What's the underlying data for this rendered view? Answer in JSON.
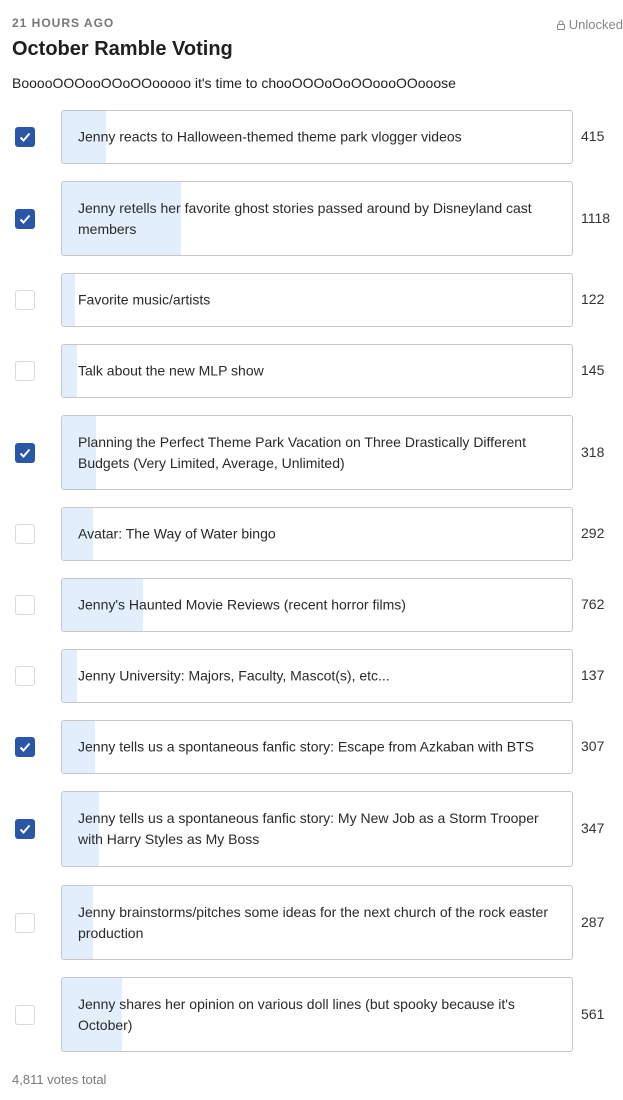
{
  "post": {
    "timestamp": "21 HOURS AGO",
    "lock_status": "Unlocked",
    "title": "October Ramble Voting",
    "description": "BooooOOOooOOoOOooooo it's time to chooOOOoOoOOoooOOooose"
  },
  "poll": {
    "options": [
      {
        "label": "Jenny reacts to Halloween-themed theme park vlogger videos",
        "votes": "415",
        "checked": true
      },
      {
        "label": "Jenny retells her favorite ghost stories passed around by Disneyland cast members",
        "votes": "1118",
        "checked": true
      },
      {
        "label": "Favorite music/artists",
        "votes": "122",
        "checked": false
      },
      {
        "label": "Talk about the new MLP show",
        "votes": "145",
        "checked": false
      },
      {
        "label": "Planning the Perfect Theme Park Vacation on Three Drastically Different Budgets (Very Limited, Average, Unlimited)",
        "votes": "318",
        "checked": true
      },
      {
        "label": "Avatar: The Way of Water bingo",
        "votes": "292",
        "checked": false
      },
      {
        "label": "Jenny's Haunted Movie Reviews (recent horror films)",
        "votes": "762",
        "checked": false
      },
      {
        "label": "Jenny University: Majors, Faculty, Mascot(s), etc...",
        "votes": "137",
        "checked": false
      },
      {
        "label": "Jenny tells us a spontaneous fanfic story: Escape from Azkaban with BTS",
        "votes": "307",
        "checked": true
      },
      {
        "label": "Jenny tells us a spontaneous fanfic story: My New Job as a Storm Trooper with Harry Styles as My Boss",
        "votes": "347",
        "checked": true
      },
      {
        "label": "Jenny brainstorms/pitches some ideas for the next church of the rock easter production",
        "votes": "287",
        "checked": false
      },
      {
        "label": "Jenny shares her opinion on various doll lines (but spooky because it's October)",
        "votes": "561",
        "checked": false
      }
    ],
    "total_label": "4,811 votes total"
  },
  "colors": {
    "accent": "#2a56a8",
    "bar_fill": "#e3eefc",
    "border": "#c6c6c6"
  }
}
